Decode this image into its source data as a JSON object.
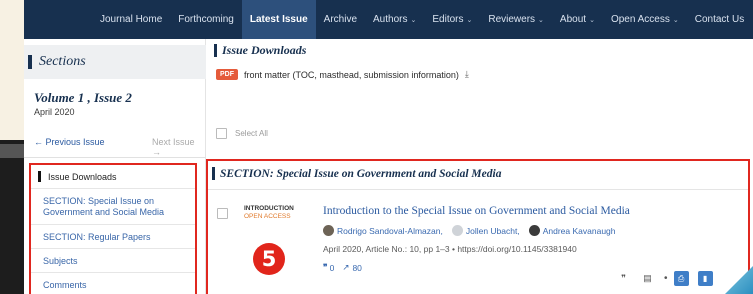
{
  "nav": {
    "items": [
      {
        "label": "Journal Home",
        "dropdown": false,
        "active": false
      },
      {
        "label": "Forthcoming",
        "dropdown": false,
        "active": false
      },
      {
        "label": "Latest Issue",
        "dropdown": false,
        "active": true
      },
      {
        "label": "Archive",
        "dropdown": false,
        "active": false
      },
      {
        "label": "Authors",
        "dropdown": true,
        "active": false
      },
      {
        "label": "Editors",
        "dropdown": true,
        "active": false
      },
      {
        "label": "Reviewers",
        "dropdown": true,
        "active": false
      },
      {
        "label": "About",
        "dropdown": true,
        "active": false
      },
      {
        "label": "Open Access",
        "dropdown": true,
        "active": false
      },
      {
        "label": "Contact Us",
        "dropdown": false,
        "active": false
      }
    ]
  },
  "sidebar": {
    "sections_title": "Sections",
    "volume": "Volume 1 , Issue 2",
    "date": "April 2020",
    "prev_issue": "← Previous Issue",
    "next_issue": "Next Issue →",
    "nav_items": [
      {
        "label": "Issue Downloads"
      },
      {
        "label": "SECTION: Special Issue on Government and Social Media"
      },
      {
        "label": "SECTION: Regular Papers"
      },
      {
        "label": "Subjects"
      },
      {
        "label": "Comments"
      }
    ]
  },
  "main": {
    "issue_downloads_title": "Issue Downloads",
    "pdf_badge": "PDF",
    "pdf_text": "front matter (TOC, masthead, submission information)",
    "select_all": "Select All",
    "section_title": "SECTION: Special Issue on Government and Social Media",
    "article": {
      "type": "INTRODUCTION",
      "access": "OPEN ACCESS",
      "title": "Introduction to the Special Issue on Government and Social Media",
      "authors": [
        "Rodrigo Sandoval-Almazan,",
        "Jollen Ubacht,",
        "Andrea Kavanaugh"
      ],
      "meta": "April 2020, Article No.: 10, pp 1–3 • https://doi.org/10.1145/3381940",
      "citations": "0",
      "downloads": "80"
    },
    "marker": "5"
  },
  "colors": {
    "nav_bg": "#17304f",
    "highlight_box": "#e0271f",
    "link": "#2b5aa0"
  }
}
